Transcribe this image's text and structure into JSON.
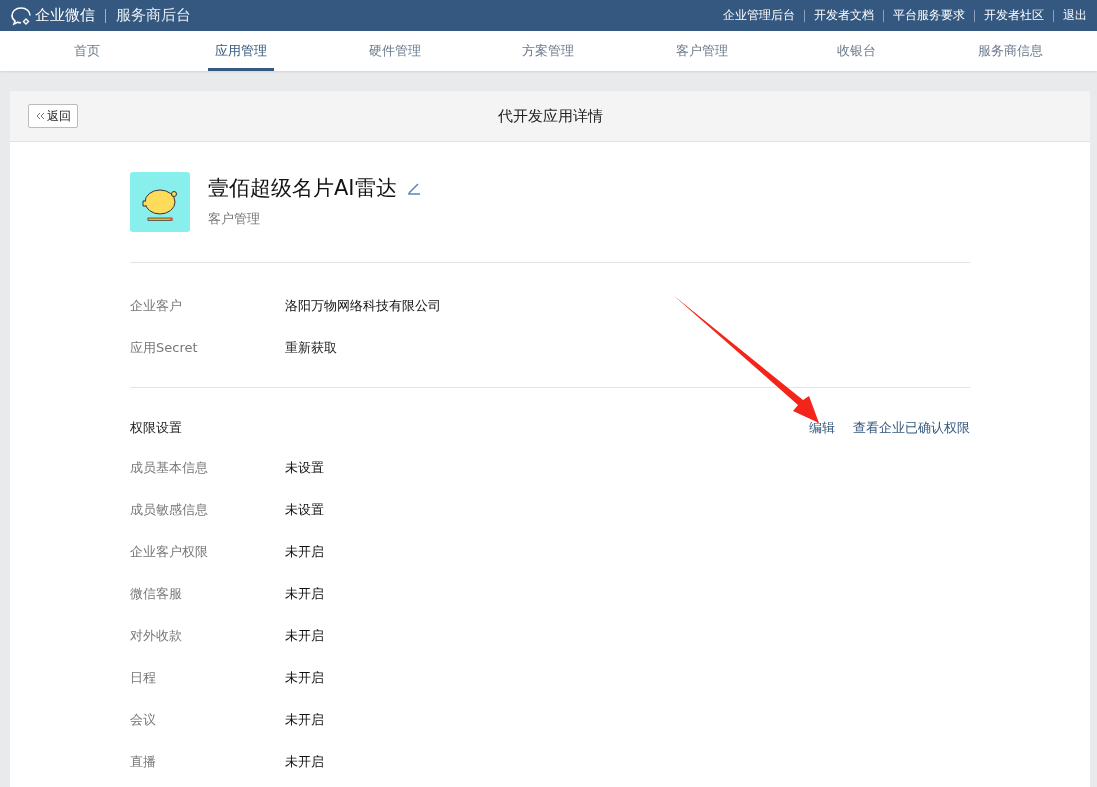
{
  "topbar": {
    "logo_text": "企业微信",
    "subtitle": "服务商后台",
    "links": [
      "企业管理后台",
      "开发者文档",
      "平台服务要求",
      "开发者社区",
      "退出"
    ]
  },
  "nav_tabs": [
    {
      "label": "首页",
      "selected": false
    },
    {
      "label": "应用管理",
      "selected": true
    },
    {
      "label": "硬件管理",
      "selected": false
    },
    {
      "label": "方案管理",
      "selected": false
    },
    {
      "label": "客户管理",
      "selected": false
    },
    {
      "label": "收银台",
      "selected": false
    },
    {
      "label": "服务商信息",
      "selected": false
    }
  ],
  "panel": {
    "back_button": "返回",
    "title": "代开发应用详情"
  },
  "app": {
    "name": "壹佰超级名片AI雷达",
    "category": "客户管理"
  },
  "info_rows": [
    {
      "label": "企业客户",
      "value": "洛阳万物网络科技有限公司",
      "kind": "text"
    },
    {
      "label": "应用Secret",
      "value": "重新获取",
      "kind": "link"
    }
  ],
  "permissions": {
    "title": "权限设置",
    "actions": [
      "编辑",
      "查看企业已确认权限"
    ],
    "rows": [
      {
        "label": "成员基本信息",
        "value": "未设置"
      },
      {
        "label": "成员敏感信息",
        "value": "未设置"
      },
      {
        "label": "企业客户权限",
        "value": "未开启"
      },
      {
        "label": "微信客服",
        "value": "未开启"
      },
      {
        "label": "对外收款",
        "value": "未开启"
      },
      {
        "label": "日程",
        "value": "未开启"
      },
      {
        "label": "会议",
        "value": "未开启"
      },
      {
        "label": "直播",
        "value": "未开启"
      }
    ]
  }
}
